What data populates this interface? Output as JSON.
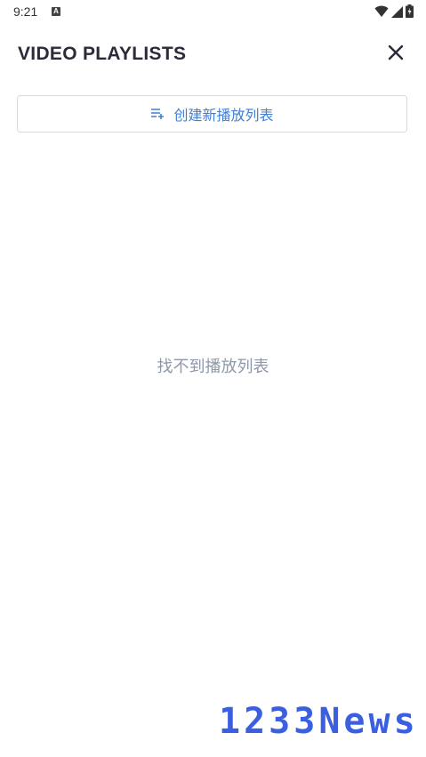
{
  "status_bar": {
    "time": "9:21",
    "notification_icon": "a-icon",
    "right_icons": [
      "wifi-icon",
      "signal-icon",
      "battery-icon"
    ]
  },
  "header": {
    "title": "VIDEO PLAYLISTS",
    "close_icon": "close-icon"
  },
  "create_button": {
    "icon": "playlist-add-icon",
    "label": "创建新播放列表"
  },
  "empty_state": {
    "message": "找不到播放列表"
  },
  "watermark": {
    "text": "1233News"
  },
  "colors": {
    "accent": "#3f7fd6",
    "title": "#2b2b3a",
    "muted": "#8e98a8",
    "border": "#d6d9de",
    "watermark": "#3a5fe0"
  }
}
